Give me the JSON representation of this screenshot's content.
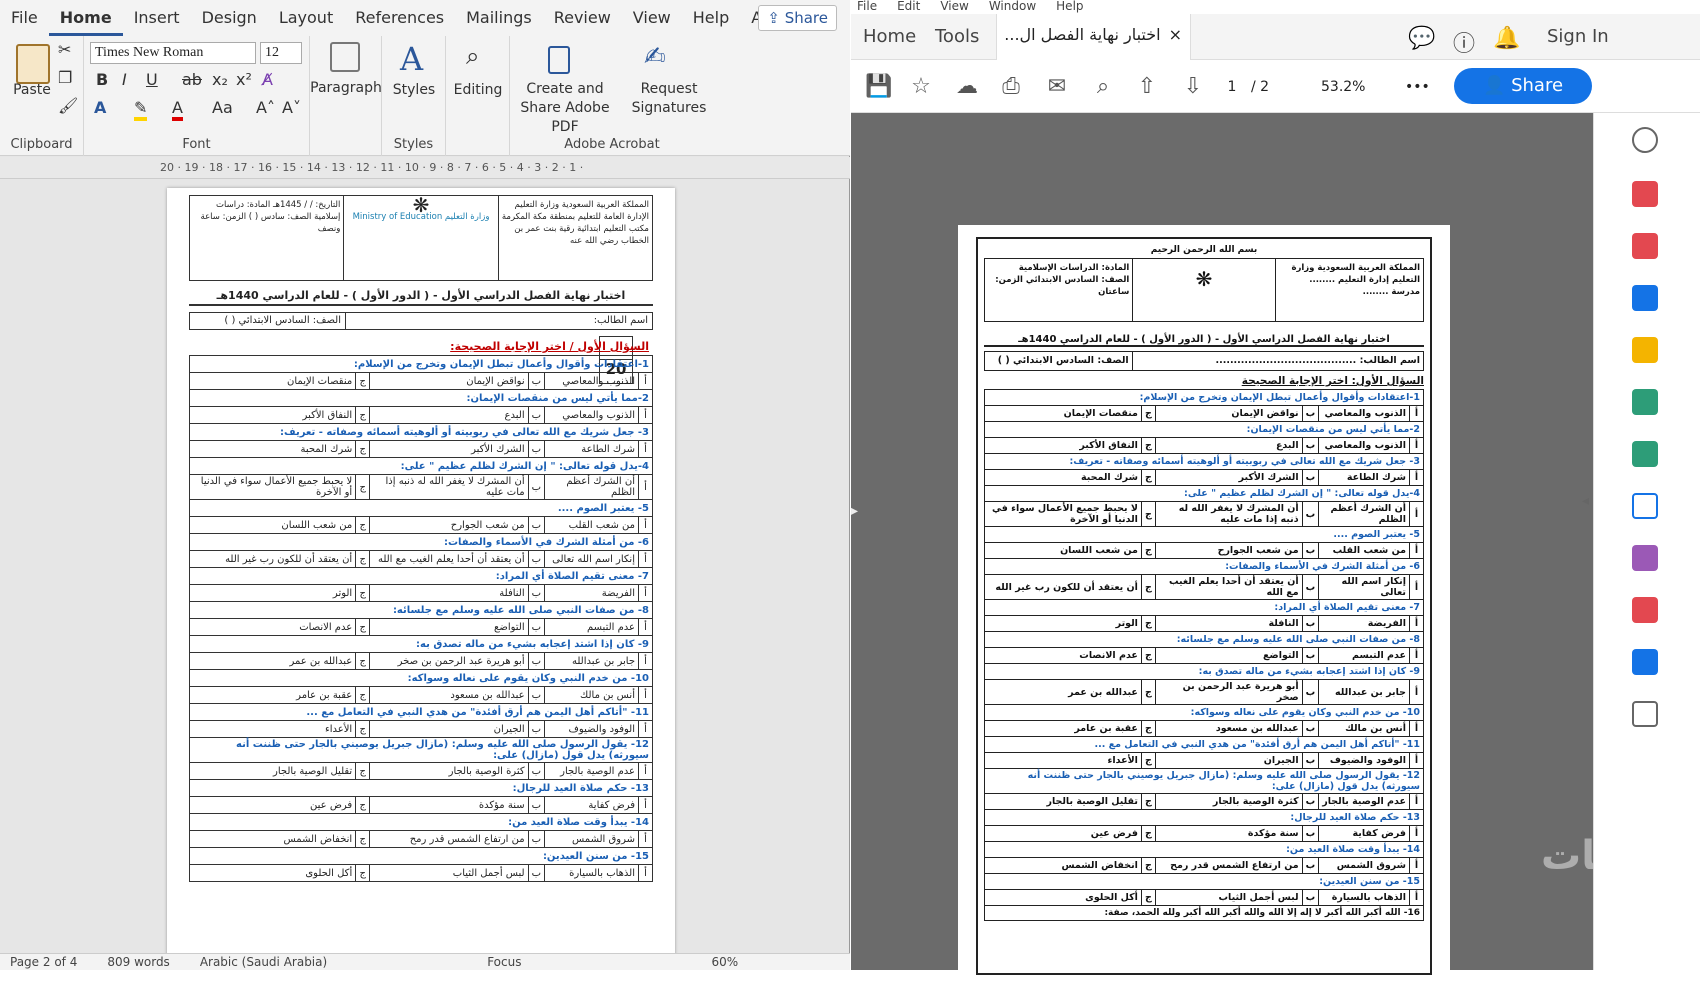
{
  "word": {
    "menu": [
      "File",
      "Home",
      "Insert",
      "Design",
      "Layout",
      "References",
      "Mailings",
      "Review",
      "View",
      "Help",
      "Acrobat"
    ],
    "active_tab": "Home",
    "share_label": "Share",
    "ribbon": {
      "paste": "Paste",
      "clipboard": "Clipboard",
      "font_name": "Times New Roman",
      "font_size": "12",
      "font": "Font",
      "paragraph": "Paragraph",
      "styles_btn": "Styles",
      "styles": "Styles",
      "editing": "Editing",
      "create_share": "Create and Share Adobe PDF",
      "request_sig": "Request Signatures",
      "adobe_acrobat": "Adobe Acrobat"
    },
    "ruler": "20 · 19 · 18 · 17 · 16 · 15 · 14 · 13 · 12 · 11 · 10 · 9 · 8 · 7 · 6 · 5 · 4 · 3 · 2 · 1 ·",
    "status": {
      "page": "Page 2 of 4",
      "words": "809 words",
      "language": "Arabic (Saudi Arabia)",
      "focus": "Focus",
      "zoom": "60%"
    },
    "doc": {
      "hdr_right": "المملكة العربية السعودية وزارة التعليم الإدارة العامة للتعليم بمنطقة مكة المكرمة مكتب التعليم ابتدائية رقية بنت عمر بن الخطاب رضي الله عنه",
      "hdr_mid": "وزارة التعليم Ministry of Education",
      "hdr_left": "التاريخ: / / 1445هـ المادة: دراسات إسلامية الصف: سادس ( ) الزمن: ساعة ونصف",
      "title": "اختبار نهاية الفصل الدراسي الأول - ( الدور الأول ) - للعام الدراسي 1440هـ",
      "name_label": "اسم الطالب:",
      "class_label": "الصف: السادس الابتدائي ( )",
      "score": "20",
      "q1_head": "السؤال الأول / اختر الإجابة الصحيحة:",
      "questions": [
        {
          "q": "1-اعتقادات وأقوال وأعمال تبطل الإيمان وتخرج من الإسلام:",
          "a": "الذنوب والمعاصي",
          "b": "نواقض الإيمان",
          "c": "منقصات الإيمان"
        },
        {
          "q": "2-مما يأتي ليس من منقصات الإيمان:",
          "a": "الذنوب والمعاصي",
          "b": "البدع",
          "c": "النفاق الأكبر"
        },
        {
          "q": "3- جعل شريك مع الله تعالى في ربوبيته أو ألوهيته أسمائه وصفاته - تعريف:",
          "a": "شرك الطاعة",
          "b": "الشرك الأكبر",
          "c": "شرك المحبة"
        },
        {
          "q": "4-يدل قوله تعالى: \" إن الشرك لظلم عظيم \" على:",
          "a": "أن الشرك أعظم الظلم",
          "b": "أن المشرك لا يغفر الله له ذنبه إذا مات عليه",
          "c": "لا يحبط جميع الأعمال سواء في الدنيا أو الآخرة"
        },
        {
          "q": "5- يعتبر الصوم ....",
          "a": "من شعب القلب",
          "b": "من شعب الجوارح",
          "c": "من شعب اللسان"
        },
        {
          "q": "6- من أمثلة الشرك في الأسماء والصفات:",
          "a": "إنكار اسم الله تعالى",
          "b": "أن يعتقد أن أحدا يعلم الغيب مع الله",
          "c": "أن يعتقد أن للكون رب غير الله"
        },
        {
          "q": "7- معنى تقيم الصلاة أي المراد:",
          "a": "الفريضة",
          "b": "النافلة",
          "c": "الوتر"
        },
        {
          "q": "8- من صفات النبي صلى الله عليه وسلم مع جلسائه:",
          "a": "عدم التبسم",
          "b": "التواضع",
          "c": "عدم الانصات"
        },
        {
          "q": "9- كان إذا اشتد إعجابه بشيء من ماله تصدق به:",
          "a": "جابر بن عبدالله",
          "b": "أبو هريرة عبد الرحمن بن صخر",
          "c": "عبدالله بن عمر"
        },
        {
          "q": "10- من خدم النبي وكان يقوم على نعاله وسواكه:",
          "a": "أنس بن مالك",
          "b": "عبدالله بن مسعود",
          "c": "عقبة بن عامر"
        },
        {
          "q": "11- \"أتاكم أهل اليمن هم أرق أفئدة\" من هدي النبي في التعامل مع ...",
          "a": "الوفود والضيوف",
          "b": "الجيران",
          "c": "الأعداء"
        },
        {
          "q": "12- يقول الرسول صلى الله عليه وسلم: (مازال جبريل يوصيني بالجار حتى ظننت أنه سيورثه) يدل قول (مازال) على:",
          "a": "عدم الوصية بالجار",
          "b": "كثرة الوصية بالجار",
          "c": "تقليل الوصية بالجار"
        },
        {
          "q": "13- حكم صلاة العيد للرجال:",
          "a": "فرض كفاية",
          "b": "سنة مؤكدة",
          "c": "فرض عين"
        },
        {
          "q": "14- يبدأ وقت صلاة العيد من:",
          "a": "شروق الشمس",
          "b": "من ارتفاع الشمس قدر رمح",
          "c": "انخفاض الشمس"
        },
        {
          "q": "15- من سنن العيدين:",
          "a": "الذهاب بالسيارة",
          "b": "لبس أجمل الثياب",
          "c": "أكل الحلوى"
        }
      ],
      "letters": [
        "أ",
        "ب",
        "ج"
      ]
    }
  },
  "acrobat": {
    "menu": [
      "File",
      "Edit",
      "View",
      "Window",
      "Help"
    ],
    "tabs": {
      "home": "Home",
      "tools": "Tools"
    },
    "doc_tab": "اختبار نهاية الفصل ال...",
    "close": "×",
    "sign_in": "Sign In",
    "page_current": "1",
    "page_total": "/ 2",
    "zoom": "53.2%",
    "more": "•••",
    "share": "Share",
    "scan": {
      "basmala": "بسم الله الرحمن الرحيم",
      "hdr_right": "المملكة العربية السعودية وزارة التعليم إدارة التعليم ........ مدرسة ........",
      "hdr_left": "المادة: الدراسات الإسلامية الصف: السادس الابتدائي الزمن: ساعتان",
      "title": "اختبار نهاية الفصل الدراسي الأول - ( الدور الأول ) - للعام الدراسي 1440هـ",
      "name": "اسم الطالب: .......................................",
      "class": "الصف: السادس الابتدائي ( )",
      "q_head": "السؤال الأول: اختر الإجابة الصحيحة",
      "last": "16- الله أكبر الله أكبر لا إله إلا الله والله أكبر الله أكبر ولله الحمد، صفة:"
    },
    "watermark": "خمسات"
  }
}
